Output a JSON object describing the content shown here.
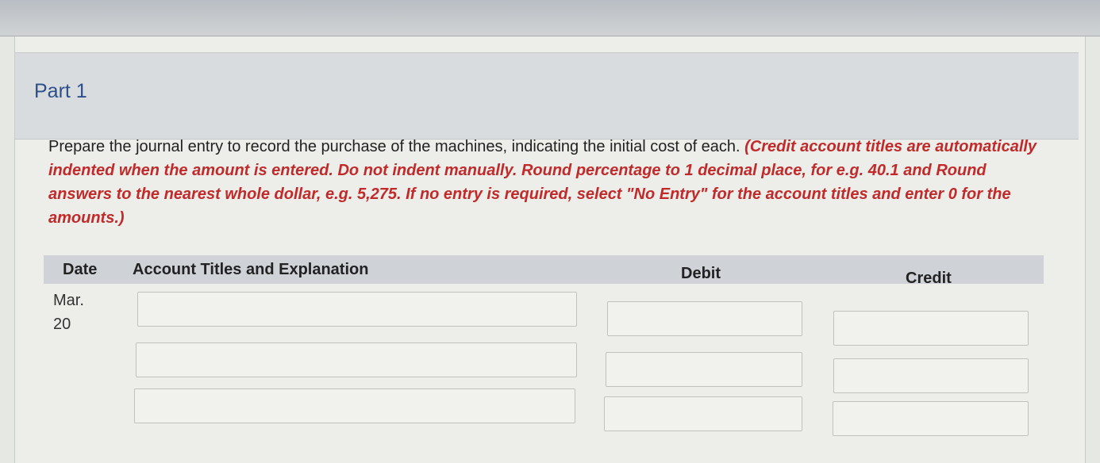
{
  "part": {
    "title": "Part 1"
  },
  "instructions": {
    "main": "Prepare the journal entry to record the purchase of the machines, indicating the initial cost of each. ",
    "note": "(Credit account titles are automatically indented when the amount is entered. Do not indent manually. Round percentage to 1 decimal place, for e.g. 40.1 and Round answers to the nearest whole dollar, e.g. 5,275. If no entry is required, select \"No Entry\" for the account titles and enter 0 for the amounts.)"
  },
  "journal": {
    "headers": {
      "date": "Date",
      "account": "Account Titles and Explanation",
      "debit": "Debit",
      "credit": "Credit"
    },
    "date_month": "Mar.",
    "date_day": "20",
    "rows": [
      {
        "account": "",
        "debit": "",
        "credit": ""
      },
      {
        "account": "",
        "debit": "",
        "credit": ""
      },
      {
        "account": "",
        "debit": "",
        "credit": ""
      }
    ]
  }
}
